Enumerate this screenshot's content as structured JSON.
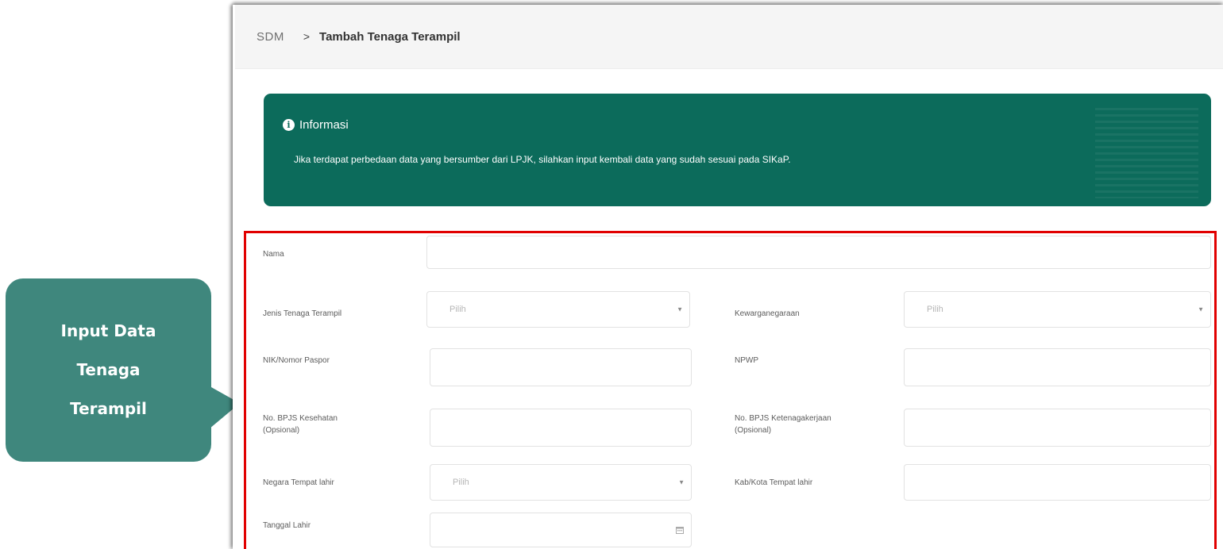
{
  "callout": {
    "lines": [
      "Input Data",
      "Tenaga",
      "Terampil"
    ]
  },
  "breadcrumb": {
    "root": "SDM",
    "separator": ">",
    "current": "Tambah Tenaga Terampil"
  },
  "info": {
    "title": "Informasi",
    "message": "Jika terdapat perbedaan data yang bersumber dari LPJK, silahkan input kembali data yang sudah sesuai pada SIKaP."
  },
  "form": {
    "nama_label": "Nama",
    "jenis_label": "Jenis Tenaga Terampil",
    "jenis_value": "Pilih",
    "kewarganegaraan_label": "Kewarganegaraan",
    "kewarganegaraan_value": "Pilih",
    "nik_label": "NIK/Nomor Paspor",
    "npwp_label": "NPWP",
    "bpjs_kes_label": "No. BPJS Kesehatan (Opsional)",
    "bpjs_tk_label": "No. BPJS Ketenagakerjaan (Opsional)",
    "negara_label": "Negara Tempat lahir",
    "negara_value": "Pilih",
    "kota_label": "Kab/Kota Tempat lahir",
    "tanggal_label": "Tanggal Lahir"
  },
  "colors": {
    "callout": "#3f877d",
    "info_banner": "#0c6b5b",
    "highlight": "#e10000"
  },
  "icons": [
    "info-icon",
    "chevron-right-icon",
    "caret-down-icon",
    "calendar-icon"
  ]
}
